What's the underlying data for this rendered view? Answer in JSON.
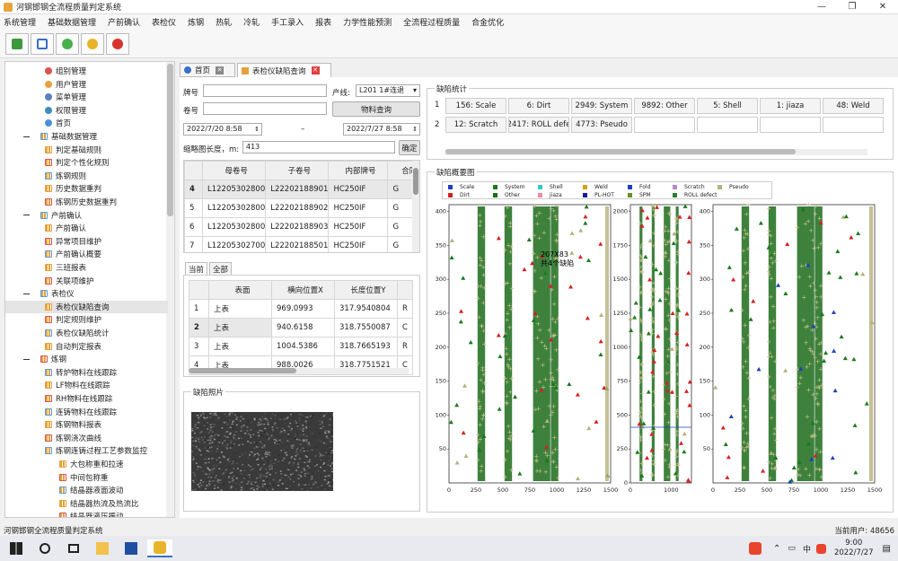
{
  "window": {
    "title": "河钢邯钢全流程质量判定系统"
  },
  "menu": [
    "系统管理",
    "基础数据管理",
    "产前确认",
    "表检仪",
    "炼钢",
    "热轧",
    "冷轧",
    "手工录入",
    "报表",
    "力学性能预测",
    "全流程过程质量",
    "合金优化"
  ],
  "tree": {
    "items": [
      {
        "label": "组别管理",
        "level": 2,
        "color": "#d9534f"
      },
      {
        "label": "用户管理",
        "level": 2,
        "color": "#e6a23c"
      },
      {
        "label": "菜单管理",
        "level": 2,
        "color": "#5b7fbf"
      },
      {
        "label": "权限管理",
        "level": 2,
        "color": "#3c8dbc"
      },
      {
        "label": "首页",
        "level": 2,
        "color": "#4a90d9"
      },
      {
        "label": "基础数据管理",
        "level": 1
      },
      {
        "label": "判定基础规则",
        "level": 2
      },
      {
        "label": "判定个性化规则",
        "level": 2
      },
      {
        "label": "炼钢规则",
        "level": 2
      },
      {
        "label": "历史数据重判",
        "level": 2
      },
      {
        "label": "炼钢历史数据重判",
        "level": 2
      },
      {
        "label": "产前确认",
        "level": 1
      },
      {
        "label": "产前确认",
        "level": 2
      },
      {
        "label": "异常项目维护",
        "level": 2
      },
      {
        "label": "产前确认概要",
        "level": 2
      },
      {
        "label": "三班报表",
        "level": 2
      },
      {
        "label": "关联项维护",
        "level": 2
      },
      {
        "label": "表检仪",
        "level": 1
      },
      {
        "label": "表检仪缺陷查询",
        "level": 2,
        "selected": true
      },
      {
        "label": "判定规则维护",
        "level": 2
      },
      {
        "label": "表检仪缺陷统计",
        "level": 2
      },
      {
        "label": "自动判定报表",
        "level": 2
      },
      {
        "label": "炼钢",
        "level": 1
      },
      {
        "label": "转炉物料在线跟踪",
        "level": 2
      },
      {
        "label": "LF物料在线跟踪",
        "level": 2
      },
      {
        "label": "RH物料在线跟踪",
        "level": 2
      },
      {
        "label": "连铸物料在线跟踪",
        "level": 2
      },
      {
        "label": "炼钢物料报表",
        "level": 2
      },
      {
        "label": "炼钢浇次曲线",
        "level": 2
      },
      {
        "label": "炼钢连铸过程工艺参数监控",
        "level": 2
      },
      {
        "label": "大包称重和拉速",
        "level": 3
      },
      {
        "label": "中间包称重",
        "level": 3
      },
      {
        "label": "结晶器液面波动",
        "level": 3
      },
      {
        "label": "结晶器热流及热流比",
        "level": 3
      },
      {
        "label": "结晶器液压振动",
        "level": 3
      }
    ]
  },
  "tabs": [
    {
      "label": "首页"
    },
    {
      "label": "表检仪缺陷查询"
    }
  ],
  "form": {
    "furnace_label": "牌号",
    "line_label": "产线:",
    "line_value": "L201 1#连退",
    "coil_label": "卷号",
    "material_button": "物料查询",
    "date_from": "2022/7/20  8:58",
    "date_sep": "–",
    "date_to": "2022/7/27  8:58",
    "thumb_label": "缩略图长度，m:",
    "thumb_value": "413",
    "confirm_button": "确定"
  },
  "coil_table": {
    "headers": [
      "母卷号",
      "子卷号",
      "内部牌号",
      "合同"
    ],
    "rows": [
      {
        "n": "4",
        "c": [
          "L12205302800",
          "L22202188901",
          "HC250IF",
          "G"
        ]
      },
      {
        "n": "5",
        "c": [
          "L12205302800",
          "L22202188902",
          "HC250IF",
          "G"
        ]
      },
      {
        "n": "6",
        "c": [
          "L12205302800",
          "L22202188903",
          "HC250IF",
          "G"
        ]
      },
      {
        "n": "7",
        "c": [
          "L12205302700",
          "L22202188501",
          "HC250IF",
          "G"
        ]
      }
    ]
  },
  "defect_tabs": [
    "当前",
    "全部"
  ],
  "defect_table": {
    "headers": [
      "表面",
      "横向位置X",
      "长度位置Y"
    ],
    "rows": [
      {
        "n": "1",
        "c": [
          "上表",
          "969.0993",
          "317.9540804",
          "R"
        ]
      },
      {
        "n": "2",
        "c": [
          "上表",
          "940.6158",
          "318.7550087",
          "C"
        ]
      },
      {
        "n": "3",
        "c": [
          "上表",
          "1004.5386",
          "318.7665193",
          "R"
        ]
      },
      {
        "n": "4",
        "c": [
          "上表",
          "988.0026",
          "318.7751521",
          "C"
        ]
      }
    ]
  },
  "photo_title": "缺陷照片",
  "stats": {
    "title": "缺陷统计",
    "row1": [
      "156: Scale",
      "6: Dirt",
      "2949: System",
      "9892: Other",
      "5: Shell",
      "1: jiaza",
      "48: Weld"
    ],
    "row2": [
      "12: Scratch",
      "2417: ROLL defe",
      "4773: Pseudo"
    ]
  },
  "overview_title": "缺陷概要图",
  "legend": [
    {
      "name": "Scale",
      "color": "#1f3fbf"
    },
    {
      "name": "System",
      "color": "#1a7a1a"
    },
    {
      "name": "Shell",
      "color": "#35c8c8"
    },
    {
      "name": "Weld",
      "color": "#d4a017"
    },
    {
      "name": "Fold",
      "color": "#1a3fbf"
    },
    {
      "name": "Scratch",
      "color": "#b48ac8"
    },
    {
      "name": "Pseudo",
      "color": "#b5b27a"
    },
    {
      "name": "Dirt",
      "color": "#d62020"
    },
    {
      "name": "Other",
      "color": "#1a6e1a"
    },
    {
      "name": "jiaza",
      "color": "#f08aa0"
    },
    {
      "name": "PL-HOT",
      "color": "#1a1a9f"
    },
    {
      "name": "SPM",
      "color": "#6b8e23"
    },
    {
      "name": "ROLL defect",
      "color": "#2e7d32"
    }
  ],
  "chart_data": [
    {
      "type": "scatter",
      "title": "",
      "xlabel": "",
      "ylabel": "",
      "xlim": [
        0,
        1500
      ],
      "ylim": [
        0,
        410
      ],
      "xticks": [
        "0",
        "250",
        "500",
        "750",
        "1000",
        "1250",
        "1500"
      ],
      "yticks": [
        "50",
        "100",
        "150",
        "200",
        "250",
        "300",
        "350",
        "400"
      ],
      "annotation": [
        "207X83",
        "共4个缺陷"
      ]
    },
    {
      "type": "scatter",
      "title": "",
      "xlim": [
        0,
        1500
      ],
      "ylim": [
        0,
        2050
      ],
      "xticks": [
        "0",
        "1000"
      ],
      "yticks": [
        "0",
        "250",
        "500",
        "750",
        "1000",
        "1250",
        "1500",
        "1750",
        "2000"
      ]
    },
    {
      "type": "scatter",
      "title": "",
      "xlim": [
        0,
        1500
      ],
      "ylim": [
        0,
        410
      ],
      "xticks": [
        "0",
        "250",
        "500",
        "750",
        "1000",
        "1250",
        "1500"
      ],
      "yticks": [
        "50",
        "100",
        "150",
        "200",
        "250",
        "300",
        "350",
        "400"
      ]
    }
  ],
  "status": {
    "left": "河钢邯钢全流程质量判定系统",
    "right": "当前用户: 48656"
  },
  "taskbar": {
    "time": "9:00",
    "date": "2022/7/27",
    "ime": "中"
  }
}
